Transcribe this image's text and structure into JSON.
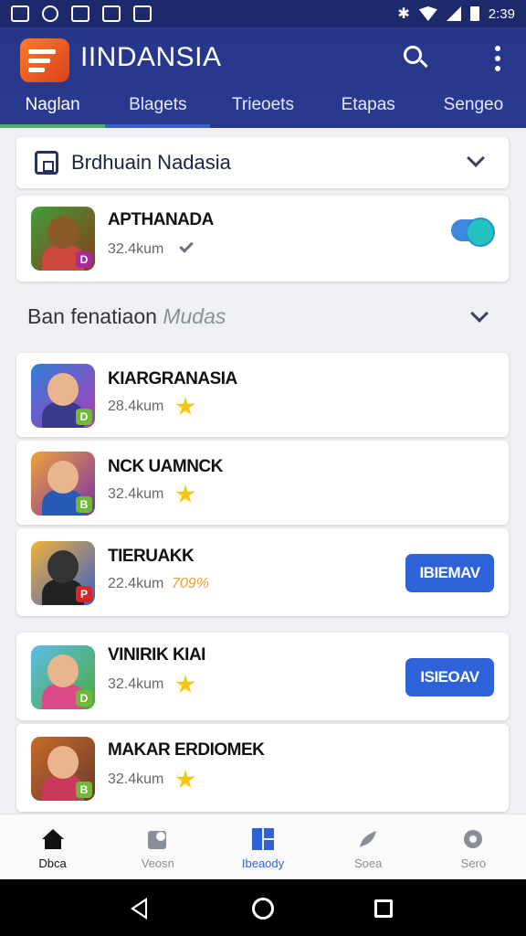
{
  "status_bar": {
    "time": "2:39"
  },
  "app_bar": {
    "title": "IINDANSIA"
  },
  "tabs": [
    {
      "label": "Naglan",
      "active": true
    },
    {
      "label": "Blagets",
      "active": false
    },
    {
      "label": "Trieoets",
      "active": false
    },
    {
      "label": "Etapas",
      "active": false
    },
    {
      "label": "Sengeo",
      "active": false
    }
  ],
  "filter": {
    "label": "Brdhuain Nadasia"
  },
  "featured": {
    "title": "APTHANADA",
    "size": "32.4kum",
    "toggle_on": true
  },
  "section": {
    "label": "Ban fenatiaon",
    "label_muted": "Mudas"
  },
  "apps": [
    {
      "title": "KIARGRANASIA",
      "size": "28.4kum",
      "badge": "D",
      "badge_color": "#6fb83a",
      "rating_text": "",
      "button": ""
    },
    {
      "title": "NCK UAMNCK",
      "size": "32.4kum",
      "badge": "B",
      "badge_color": "#6fb83a",
      "rating_text": "",
      "button": ""
    },
    {
      "title": "TIERUAKK",
      "size": "22.4kum",
      "badge": "P",
      "badge_color": "#d8262e",
      "rating_text": "709%",
      "button": "IBIEMAV"
    },
    {
      "title": "VINIRIK KIAI",
      "size": "32.4kum",
      "badge": "D",
      "badge_color": "#6fb83a",
      "rating_text": "",
      "button": "ISIEOAV"
    },
    {
      "title": "MAKAR ERDIOMEK",
      "size": "32.4kum",
      "badge": "B",
      "badge_color": "#6fb83a",
      "rating_text": "",
      "button": ""
    }
  ],
  "bottom_nav": [
    {
      "label": "Dbca",
      "icon": "home-icon"
    },
    {
      "label": "Veosn",
      "icon": "puzzle-icon"
    },
    {
      "label": "Ibeaody",
      "icon": "grid-icon",
      "active": true
    },
    {
      "label": "Soea",
      "icon": "bird-icon"
    },
    {
      "label": "Sero",
      "icon": "gear-icon"
    }
  ],
  "colors": {
    "primary": "#26368a",
    "accent": "#2e63d8",
    "tab_indicator": "#4caf6a",
    "star": "#f5c518"
  }
}
